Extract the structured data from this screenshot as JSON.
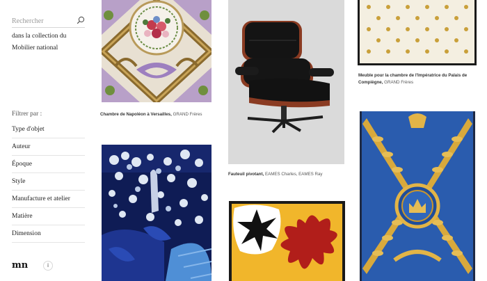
{
  "search": {
    "placeholder": "Rechercher"
  },
  "collection_text": "dans la collection du Mobilier national",
  "filters": {
    "title": "Filtrer par :",
    "items": [
      {
        "label": "Type d'objet"
      },
      {
        "label": "Auteur"
      },
      {
        "label": "Époque"
      },
      {
        "label": "Style"
      },
      {
        "label": "Manufacture et atelier"
      },
      {
        "label": "Matière"
      },
      {
        "label": "Dimension"
      }
    ]
  },
  "info_label": "i",
  "logo_text": "mn",
  "cards": [
    {
      "title": "Chambre de Napoléon à Versailles,",
      "author": "GRAND Frères"
    },
    {
      "title": "Fauteuil pivotant,",
      "author": "EAMES Charles, EAMES Ray"
    },
    {
      "title": "Meuble pour la chambre de l'Impératrice du Palais de Compiègne,",
      "author": "GRAND Frères"
    }
  ],
  "colors": {
    "lavender": "#b8a0c8",
    "chair_black": "#111111",
    "chair_wood": "#8a3b22",
    "night_blue": "#0f1c55",
    "royal_blue": "#2a5cae",
    "gold": "#d8a93c",
    "yellow": "#f1b62b",
    "red": "#b11e1a"
  }
}
